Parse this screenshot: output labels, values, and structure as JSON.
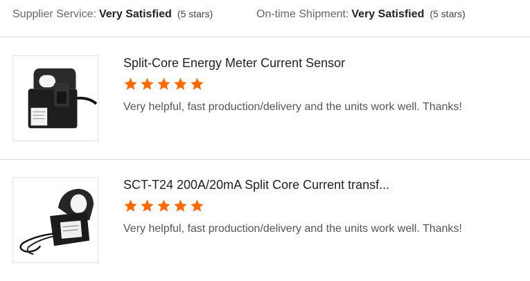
{
  "ratings": {
    "supplier_service": {
      "label": "Supplier Service:",
      "value": "Very Satisfied",
      "stars": "(5 stars)"
    },
    "ontime_shipment": {
      "label": "On-time Shipment:",
      "value": "Very Satisfied",
      "stars": "(5 stars)"
    }
  },
  "star_color": "#ff6a00",
  "reviews": [
    {
      "title": "Split-Core Energy Meter Current Sensor",
      "rating": 5,
      "comment": "Very helpful, fast production/delivery and the units work well. Thanks!",
      "image_icon": "split-core-sensor-photo"
    },
    {
      "title": "SCT-T24 200A/20mA Split Core Current transf...",
      "rating": 5,
      "comment": "Very helpful, fast production/delivery and the units work well. Thanks!",
      "image_icon": "split-core-transformer-photo"
    }
  ]
}
